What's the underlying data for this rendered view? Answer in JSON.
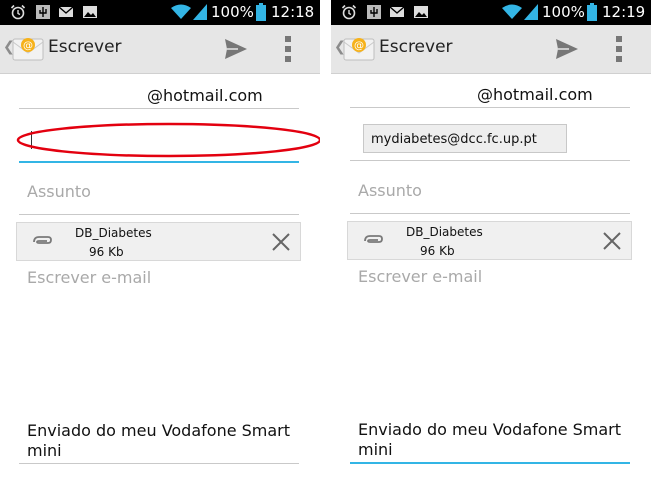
{
  "left_screen": {
    "status": {
      "battery_percent": "100%",
      "time": "12:18"
    },
    "actionbar": {
      "title": "Escrever",
      "send_icon": "send-icon",
      "overflow_icon": "more-vert-icon"
    },
    "to_field": {
      "value": "@hotmail.com"
    },
    "cc_field": {
      "value": "",
      "highlight_color": "#e3000f"
    },
    "subject": {
      "placeholder": "Assunto"
    },
    "attachment": {
      "name": "DB_Diabetes",
      "size": "96 Kb"
    },
    "body": {
      "placeholder": "Escrever e-mail"
    },
    "signature": {
      "text": "Enviado do meu Vodafone Smart mini"
    }
  },
  "right_screen": {
    "status": {
      "battery_percent": "100%",
      "time": "12:19"
    },
    "actionbar": {
      "title": "Escrever",
      "send_icon": "send-icon",
      "overflow_icon": "more-vert-icon"
    },
    "to_field": {
      "value": "@hotmail.com"
    },
    "cc_field": {
      "chip": "mydiabetes@dcc.fc.up.pt"
    },
    "subject": {
      "placeholder": "Assunto"
    },
    "attachment": {
      "name": "DB_Diabetes",
      "size": "96 Kb"
    },
    "body": {
      "placeholder": "Escrever e-mail"
    },
    "signature": {
      "text": "Enviado do meu Vodafone Smart mini"
    }
  },
  "colors": {
    "accent": "#33b5e5",
    "statusbar": "#000000",
    "actionbar": "#e6e6e6",
    "wifi": "#33b5e5"
  }
}
